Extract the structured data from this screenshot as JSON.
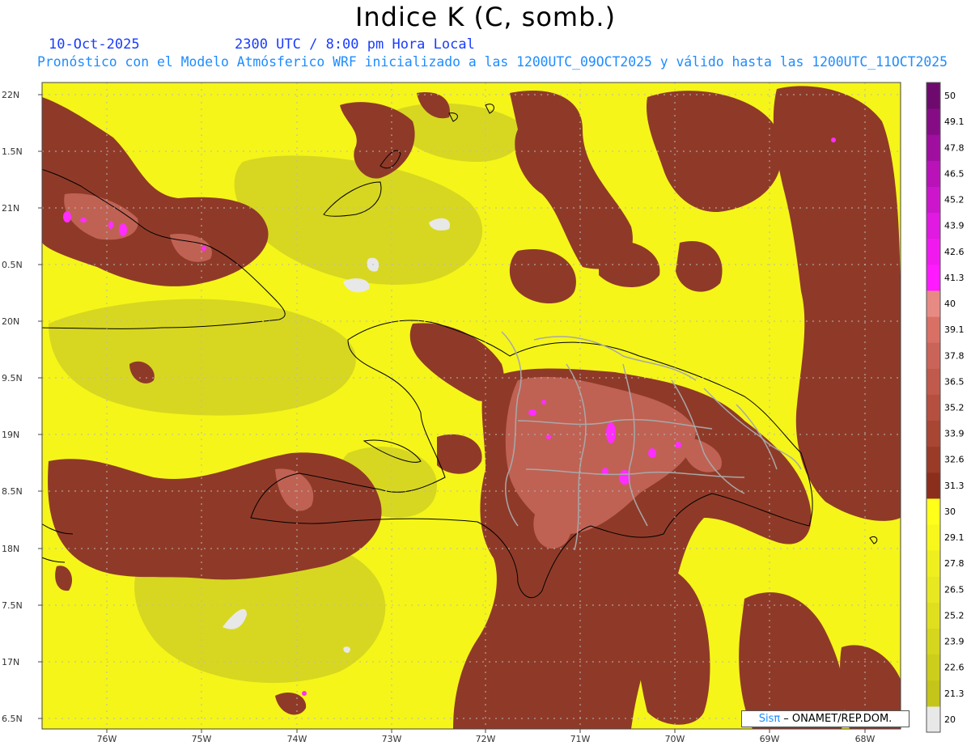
{
  "header": {
    "title": "Indice K (C, somb.)",
    "date": "10-Oct-2025",
    "time": "2300 UTC / 8:00 pm Hora Local",
    "description": "Pronóstico con el Modelo Atmósferico WRF inicializado a las 1200UTC_09OCT2025 y válido hasta las  1200UTC_11OCT2025"
  },
  "map": {
    "lat_labels": [
      "22N",
      "1.5N",
      "21N",
      "0.5N",
      "20N",
      "9.5N",
      "19N",
      "8.5N",
      "18N",
      "7.5N",
      "17N",
      "6.5N"
    ],
    "lon_labels": [
      "76W",
      "75W",
      "74W",
      "73W",
      "72W",
      "71W",
      "70W",
      "69W",
      "68W"
    ],
    "colors": {
      "yellow": "#f5f51a",
      "olive": "#d4d422",
      "brown": "#8f3a28",
      "mid_brown": "#b5584a",
      "salmon": "#e17e76",
      "magenta": "#ff2dff",
      "cloud": "#e8e8e8"
    }
  },
  "colorbar": {
    "levels": [
      "20",
      "21.3",
      "22.6",
      "23.9",
      "25.2",
      "26.5",
      "27.8",
      "29.1",
      "30",
      "31.3",
      "32.6",
      "33.9",
      "35.2",
      "36.5",
      "37.8",
      "39.1",
      "40",
      "41.3",
      "42.6",
      "43.9",
      "45.2",
      "46.5",
      "47.8",
      "49.1",
      "50"
    ],
    "colors": [
      "#e8e8e8",
      "#c4c41a",
      "#cdcd1c",
      "#d6d61e",
      "#dfdf20",
      "#e8e822",
      "#efef20",
      "#f7f71c",
      "#ffff1a",
      "#8b2f1c",
      "#9a3b28",
      "#a84634",
      "#b55040",
      "#c05a4c",
      "#cb6458",
      "#d87066",
      "#e88a84",
      "#ff1aff",
      "#f01aef",
      "#e01ae0",
      "#cc16cc",
      "#b812b8",
      "#a00ea0",
      "#860c86",
      "#6e0a6e"
    ]
  },
  "credit": {
    "sis": "Sisπ",
    "org": " – ONAMET/REP.DOM."
  }
}
